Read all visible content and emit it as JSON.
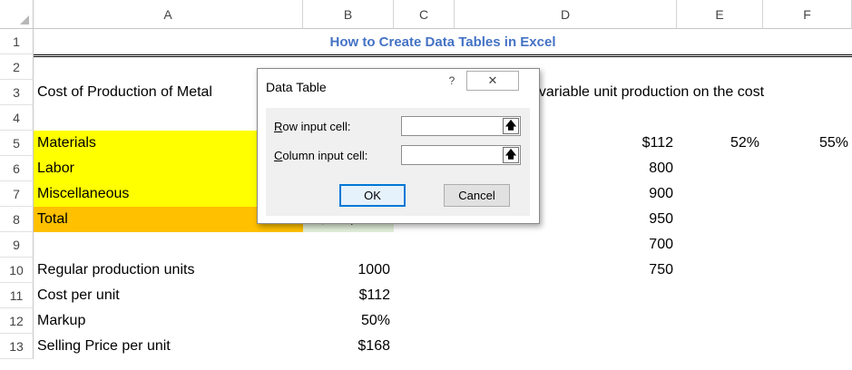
{
  "columns": [
    "A",
    "B",
    "C",
    "D",
    "E",
    "F"
  ],
  "rows": [
    "1",
    "2",
    "3",
    "4",
    "5",
    "6",
    "7",
    "8",
    "9",
    "10",
    "11",
    "12",
    "13"
  ],
  "title": "How to Create Data Tables in Excel",
  "cells": {
    "a3": "Cost of Production of Metal",
    "d3": "f variable unit production on the cost",
    "a5": "Materials",
    "a6": "Labor",
    "a7": "Miscellaneous",
    "a8": "Total",
    "b8": "$112,000",
    "d5": "$112",
    "e5": "52%",
    "f5": "55%",
    "d6": "800",
    "d7": "900",
    "d8": "950",
    "d9": "700",
    "d10": "750",
    "a10": "Regular production units",
    "b10": "1000",
    "a11": "Cost per unit",
    "b11": "$112",
    "a12": "Markup",
    "b12": "50%",
    "a13": "Selling Price per unit",
    "b13": "$168"
  },
  "dialog": {
    "title": "Data Table",
    "help_glyph": "?",
    "close_glyph": "✕",
    "row_label_key": "R",
    "row_label_rest": "ow input cell:",
    "col_label_key": "C",
    "col_label_rest": "olumn input cell:",
    "row_value": "",
    "col_value": "",
    "collapse_glyph": "🡅",
    "ok_label": "OK",
    "cancel_label": "Cancel"
  },
  "colors": {
    "yellow_fill": "#ffff00",
    "orange_fill": "#ffc000",
    "title_blue": "#4472c4",
    "ok_border": "#0078d7"
  }
}
